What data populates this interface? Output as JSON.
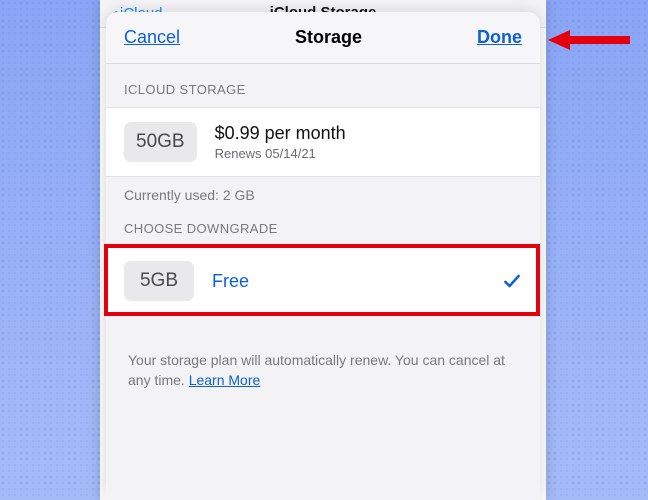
{
  "behind": {
    "back_label": "iCloud",
    "title": "iCloud Storage"
  },
  "nav": {
    "cancel": "Cancel",
    "title": "Storage",
    "done": "Done"
  },
  "sections": {
    "current_header": "ICLOUD STORAGE",
    "current": {
      "size": "50GB",
      "price": "$0.99 per month",
      "renews": "Renews 05/14/21"
    },
    "usage": "Currently used: 2 GB",
    "downgrade_header": "CHOOSE DOWNGRADE",
    "downgrade": {
      "size": "5GB",
      "label": "Free"
    }
  },
  "footer": {
    "text": "Your storage plan will automatically renew. You can cancel at any time. ",
    "learn_more": "Learn More"
  }
}
